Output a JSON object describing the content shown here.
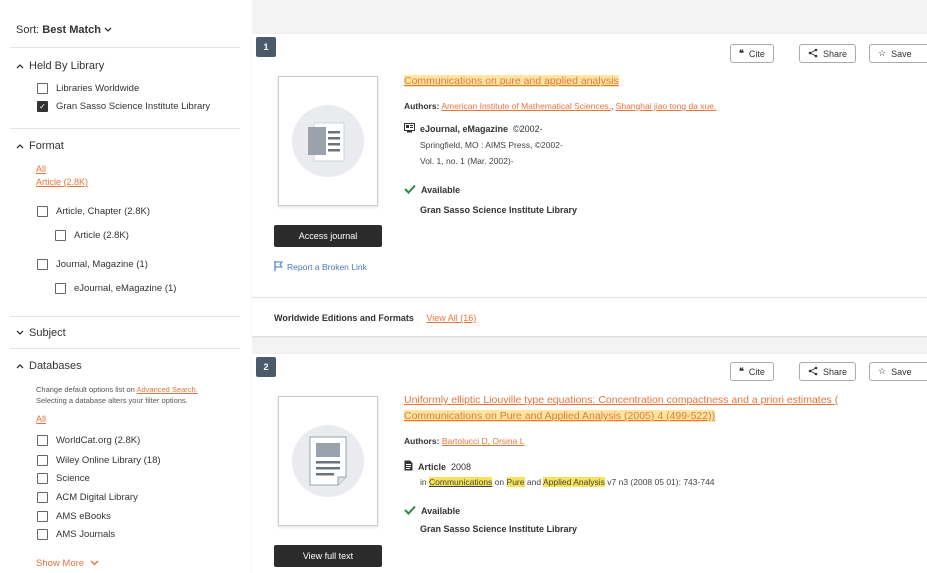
{
  "sort": {
    "label": "Sort:",
    "value": "Best Match"
  },
  "filters": {
    "held_by": {
      "title": "Held By Library",
      "options": [
        {
          "label": "Libraries Worldwide",
          "checked": false
        },
        {
          "label": "Gran Sasso Science Institute Library",
          "checked": true
        }
      ]
    },
    "format": {
      "title": "Format",
      "links": [
        "All",
        "Article (2.8K)"
      ],
      "options": [
        {
          "label": "Article, Chapter (2.8K)"
        },
        {
          "label": "Article (2.8K)"
        },
        {
          "label": "Journal, Magazine (1)"
        },
        {
          "label": "eJournal, eMagazine (1)"
        }
      ]
    },
    "subject": {
      "title": "Subject"
    },
    "databases": {
      "title": "Databases",
      "note_part1": "Change default options list on",
      "note_link": "Advanced Search.",
      "note_part2": "Selecting a database alters your filter options.",
      "all_link": "All",
      "options": [
        {
          "label": "WorldCat.org (2.8K)"
        },
        {
          "label": "Wiley Online Library (18)"
        },
        {
          "label": "Science"
        },
        {
          "label": "ACM Digital Library"
        },
        {
          "label": "AMS eBooks"
        },
        {
          "label": "AMS Journals"
        }
      ],
      "show_more": "Show More"
    }
  },
  "actions": {
    "cite": "Cite",
    "share": "Share",
    "save": "Save"
  },
  "results": [
    {
      "index": "1",
      "title": "Communications on pure and applied analysis",
      "authors_label": "Authors:",
      "authors": [
        "American Institute of Mathematical Sciences.",
        "Shanghai jiao tong da xue."
      ],
      "format": "eJournal, eMagazine",
      "format_year": "©2002-",
      "details": [
        "Springfield, MO : AIMS Press, ©2002-",
        "Vol. 1, no. 1 (Mar. 2002)-"
      ],
      "availability": "Available",
      "library": "Gran Sasso Science Institute Library",
      "button": "Access journal",
      "report_link": "Report a Broken Link",
      "editions_label": "Worldwide Editions and Formats",
      "editions_link": "View All (16)"
    },
    {
      "index": "2",
      "title_part1": "Uniformly elliptic Liouville type equations: Concentration compactness and a priori estimates (",
      "title_part2": "Communications on Pure and Applied Analysis (2005) 4 (499-522))",
      "authors_label": "Authors:",
      "authors_text": "Bartolucci D, Orsina L",
      "format": "Article",
      "format_year": "2008",
      "detail_in": "in",
      "detail_w1": "Communications",
      "detail_on": "on",
      "detail_w2": "Pure",
      "detail_and": "and",
      "detail_w3": "Applied Analysis",
      "detail_rest": "v7 n3 (2008 05 01): 743-744",
      "availability": "Available",
      "library": "Gran Sasso Science Institute Library",
      "button": "View full text"
    }
  ]
}
